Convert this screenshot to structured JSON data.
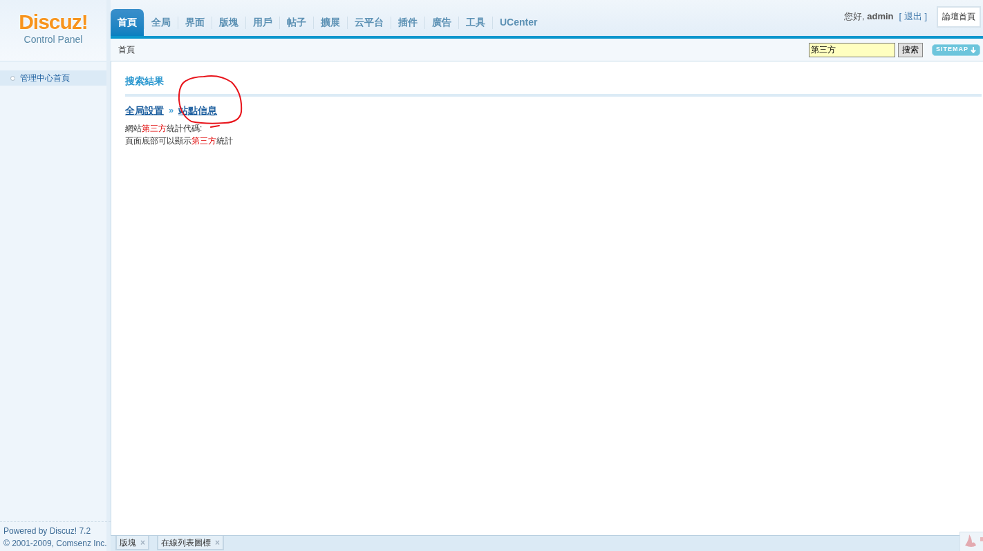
{
  "logo": {
    "title": "Discuz!",
    "subtitle": "Control Panel"
  },
  "tabs": [
    {
      "label": "首頁",
      "selected": true
    },
    {
      "label": "全局",
      "selected": false
    },
    {
      "label": "界面",
      "selected": false
    },
    {
      "label": "版塊",
      "selected": false
    },
    {
      "label": "用戶",
      "selected": false
    },
    {
      "label": "帖子",
      "selected": false
    },
    {
      "label": "擴展",
      "selected": false
    },
    {
      "label": "云平台",
      "selected": false
    },
    {
      "label": "插件",
      "selected": false
    },
    {
      "label": "廣告",
      "selected": false
    },
    {
      "label": "工具",
      "selected": false
    },
    {
      "label": "UCenter",
      "selected": false
    }
  ],
  "user_bar": {
    "greeting": "您好, **admin**",
    "logout": "[ 退出 ]",
    "forum_home": "論壇首頁"
  },
  "breadcrumb": "首頁",
  "search": {
    "value": "第三方",
    "button": "搜索"
  },
  "sitemap": "SITEMAP",
  "sidebar": {
    "items": [
      {
        "label": "管理中心首頁",
        "selected": true
      }
    ],
    "footer": [
      "Powered by Discuz! 7.2",
      "© 2001-2009, Comsenz Inc."
    ]
  },
  "content": {
    "title": "搜索結果",
    "results": [
      {
        "path": [
          "全局設置",
          "站點信息"
        ],
        "separator": "»",
        "lines": [
          [
            {
              "text": "網站",
              "highlight": false
            },
            {
              "text": "第三方",
              "highlight": true
            },
            {
              "text": "統計代碼:",
              "highlight": false
            }
          ],
          [
            {
              "text": "頁面底部可以顯示",
              "highlight": false
            },
            {
              "text": "第三方",
              "highlight": true
            },
            {
              "text": "統計",
              "highlight": false
            }
          ]
        ]
      }
    ]
  },
  "bottom_tabs": [
    {
      "label": "版塊",
      "close": "×"
    },
    {
      "label": "在線列表圖標",
      "close": "×"
    }
  ]
}
